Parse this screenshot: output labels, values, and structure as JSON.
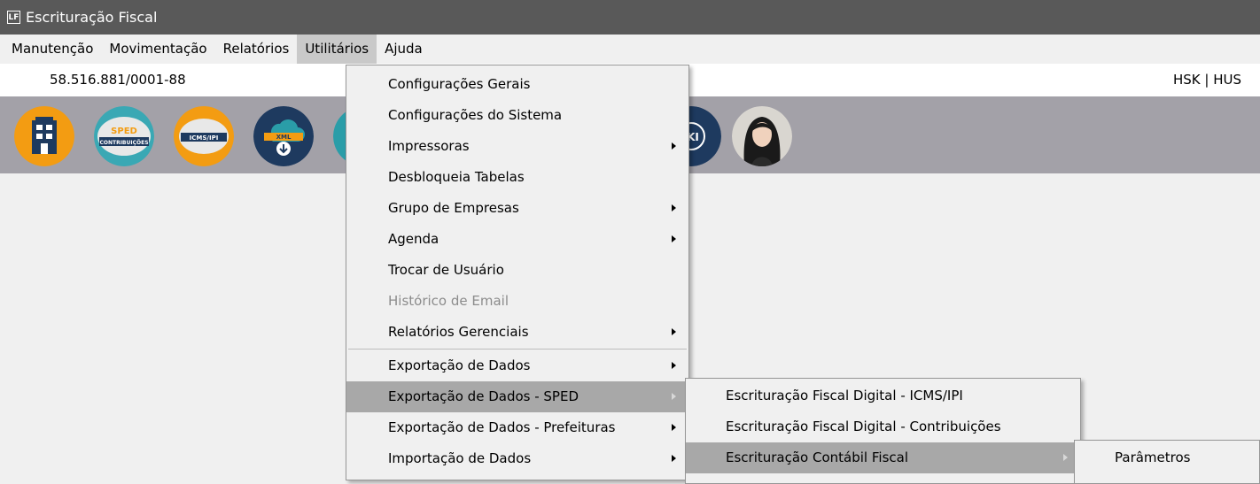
{
  "window": {
    "title": "Escrituração Fiscal",
    "icon_text": "LF"
  },
  "menubar": [
    "Manutenção",
    "Movimentação",
    "Relatórios",
    "Utilitários",
    "Ajuda"
  ],
  "info": {
    "cnpj": "58.516.881/0001-88",
    "user": "HSK | HUS"
  },
  "toolbar": {
    "icons": [
      "building-icon",
      "sped-contribuicoes-icon",
      "icms-ipi-icon",
      "xml-download-icon",
      "teal-icon",
      "wiki-icon",
      "user-avatar"
    ],
    "sped_line1": "SPED",
    "sped_line2": "CONTRIBUIÇÕES",
    "icms_label": "ICMS/IPI",
    "xml_label": "XML",
    "wiki_label": "KI"
  },
  "utilitarios_menu": [
    {
      "label": "Configurações Gerais",
      "submenu": false,
      "enabled": true
    },
    {
      "label": "Configurações do Sistema",
      "submenu": false,
      "enabled": true
    },
    {
      "label": "Impressoras",
      "submenu": true,
      "enabled": true
    },
    {
      "label": "Desbloqueia Tabelas",
      "submenu": false,
      "enabled": true
    },
    {
      "label": "Grupo de Empresas",
      "submenu": true,
      "enabled": true
    },
    {
      "label": "Agenda",
      "submenu": true,
      "enabled": true
    },
    {
      "label": "Trocar de Usuário",
      "submenu": false,
      "enabled": true
    },
    {
      "label": "Histórico de Email",
      "submenu": false,
      "enabled": false
    },
    {
      "label": "Relatórios Gerenciais",
      "submenu": true,
      "enabled": true
    },
    {
      "label": "Exportação de Dados",
      "submenu": true,
      "enabled": true
    },
    {
      "label": "Exportação de Dados - SPED",
      "submenu": true,
      "enabled": true,
      "highlighted": true
    },
    {
      "label": "Exportação de Dados - Prefeituras",
      "submenu": true,
      "enabled": true
    },
    {
      "label": "Importação de Dados",
      "submenu": true,
      "enabled": true
    }
  ],
  "sped_submenu": [
    {
      "label": "Escrituração Fiscal Digital - ICMS/IPI",
      "submenu": false
    },
    {
      "label": "Escrituração Fiscal Digital - Contribuições",
      "submenu": false
    },
    {
      "label": "Escrituração Contábil Fiscal",
      "submenu": true,
      "highlighted": true
    }
  ],
  "ecf_submenu": [
    {
      "label": "Parâmetros"
    }
  ],
  "colors": {
    "titlebar": "#595959",
    "toolbar": "#a3a1a8",
    "menu_highlight": "#a8a8a8",
    "icon_orange": "#f39c12",
    "icon_navy": "#1e3a5f",
    "icon_teal": "#2a9da8"
  }
}
